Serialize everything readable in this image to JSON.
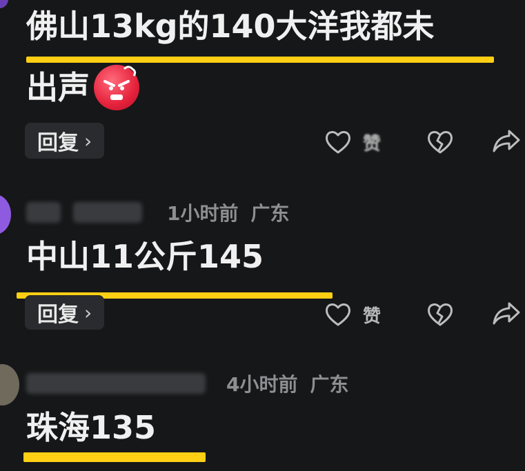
{
  "comments": [
    {
      "text_line1": "佛山13kg的140大洋我都未",
      "text_line2": "出声",
      "emoji": "angry-red-face",
      "reply_label": "回复",
      "like_label": "赞"
    },
    {
      "time": "1小时前",
      "location": "广东",
      "text": "中山11公斤145",
      "reply_label": "回复",
      "like_label": "赞"
    },
    {
      "time": "4小时前",
      "location": "广东",
      "text": "珠海135"
    }
  ],
  "colors": {
    "background": "#161719",
    "highlight_underline": "#ffcf14",
    "button_bg": "#2a2b2e",
    "meta_text": "#8f8f93"
  },
  "icons": [
    "heart-icon",
    "broken-heart-icon",
    "share-arrow-icon",
    "chevron-right-icon"
  ]
}
